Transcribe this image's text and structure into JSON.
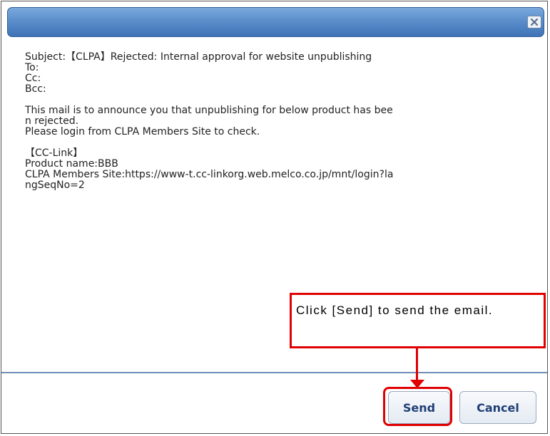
{
  "dialog": {
    "close_icon": "close-icon",
    "title_gradient": [
      "#7aa9dc",
      "#3f73b6"
    ]
  },
  "email": {
    "body_lines": [
      "Subject:【CLPA】Rejected: Internal approval for website unpublishing",
      "To:",
      "Cc:",
      "Bcc:",
      "",
      "This mail is to announce you that unpublishing for below product has bee",
      "n rejected.",
      "Please login from CLPA Members Site to check.",
      "",
      "【CC-Link】",
      "Product name:BBB",
      "CLPA Members Site:https://www-t.cc-linkorg.web.melco.co.jp/mnt/login?la",
      "ngSeqNo=2"
    ]
  },
  "buttons": {
    "send_label": "Send",
    "cancel_label": "Cancel"
  },
  "annotation": {
    "callout_text": "Click [Send] to send the email.",
    "highlight_color": "#e00000"
  }
}
